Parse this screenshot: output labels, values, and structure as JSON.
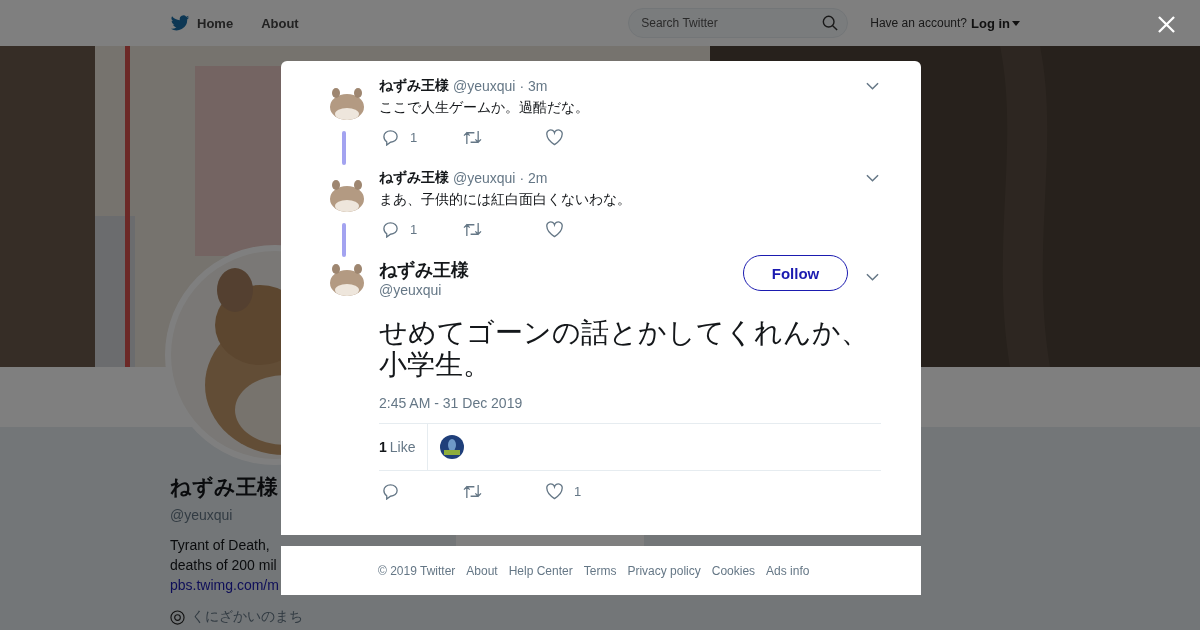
{
  "nav": {
    "home": "Home",
    "about": "About",
    "search": {
      "placeholder": "Search Twitter"
    },
    "account_prompt": "Have an account?",
    "login": "Log in"
  },
  "profile": {
    "name": "ねずみ王様",
    "handle": "@yeuxqui",
    "bio_lines": [
      "Tyrant of Death,",
      "deaths of 200 mil"
    ],
    "link": "pbs.twimg.com/m",
    "location": "くにざかいのまち"
  },
  "thread": [
    {
      "name": "ねずみ王様",
      "handle": "@yeuxqui",
      "time": "· 3m",
      "text": "ここで人生ゲームか。過酷だな。",
      "replies": "1"
    },
    {
      "name": "ねずみ王様",
      "handle": "@yeuxqui",
      "time": "· 2m",
      "text": "まあ、子供的には紅白面白くないわな。",
      "replies": "1"
    }
  ],
  "tweet": {
    "name": "ねずみ王様",
    "handle": "@yeuxqui",
    "follow": "Follow",
    "text": "せめてゴーンの話とかしてくれんか、小学生。",
    "timestamp": "2:45 AM - 31 Dec 2019",
    "likes_count": "1",
    "likes_label": "Like",
    "like_count": "1"
  },
  "footer": [
    "© 2019 Twitter",
    "About",
    "Help Center",
    "Terms",
    "Privacy policy",
    "Cookies",
    "Ads info"
  ]
}
